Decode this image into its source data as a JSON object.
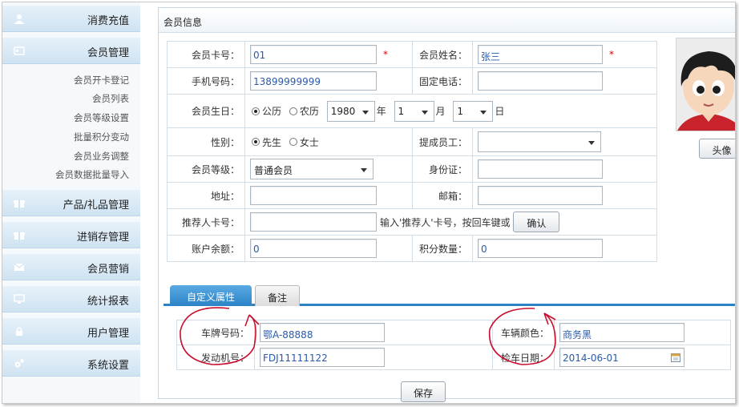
{
  "sidebar": {
    "sections": [
      {
        "label": "消费充值",
        "icon": "user-icon"
      },
      {
        "label": "会员管理",
        "icon": "member-card-icon",
        "items": [
          "会员开卡登记",
          "会员列表",
          "会员等级设置",
          "批量积分变动",
          "会员业务调整",
          "会员数据批量导入"
        ]
      },
      {
        "label": "产品/礼品管理",
        "icon": "gift-icon"
      },
      {
        "label": "进销存管理",
        "icon": "gift-icon"
      },
      {
        "label": "会员营销",
        "icon": "mail-icon"
      },
      {
        "label": "统计报表",
        "icon": "monitor-icon"
      },
      {
        "label": "用户管理",
        "icon": "lock-icon"
      },
      {
        "label": "系统设置",
        "icon": "gear-icon"
      }
    ]
  },
  "panel": {
    "title": "会员信息"
  },
  "form": {
    "card_no_label": "会员卡号：",
    "card_no": "01",
    "required_mark": "*",
    "name_label": "会员姓名：",
    "name": "张三",
    "mobile_label": "手机号码：",
    "mobile": "13899999999",
    "phone_label": "固定电话：",
    "phone": "",
    "birthday_label": "会员生日：",
    "calendar_solar": "公历",
    "calendar_lunar": "农历",
    "year": "1980",
    "year_unit": "年",
    "month": "1",
    "month_unit": "月",
    "day": "1",
    "day_unit": "日",
    "gender_label": "性别：",
    "gender_male": "先生",
    "gender_female": "女士",
    "staff_label": "提成员工：",
    "staff": "",
    "level_label": "会员等级：",
    "level": "普通会员",
    "id_label": "身份证：",
    "id": "",
    "address_label": "地址：",
    "address": "",
    "email_label": "邮箱：",
    "email": "",
    "referrer_label": "推荐人卡号：",
    "referrer": "",
    "referrer_hint": "输入'推荐人'卡号，按回车键或",
    "confirm_label": "确认",
    "balance_label": "账户余额：",
    "balance": "0",
    "points_label": "积分数量：",
    "points": "0"
  },
  "avatar": {
    "button_label": "头像"
  },
  "tabs": [
    {
      "label": "自定义属性"
    },
    {
      "label": "备注"
    }
  ],
  "custom": {
    "plate_label": "车牌号码：",
    "plate": "鄂A-88888",
    "color_label": "车辆颜色：",
    "color": "商务黑",
    "engine_label": "发动机号：",
    "engine": "FDJ11111122",
    "inspect_label": "检车日期：",
    "inspect": "2014-06-01"
  },
  "save_label": "保存",
  "colors": {
    "accent": "#2b83c6",
    "required": "#dd0000",
    "annotation": "#c8102e"
  }
}
